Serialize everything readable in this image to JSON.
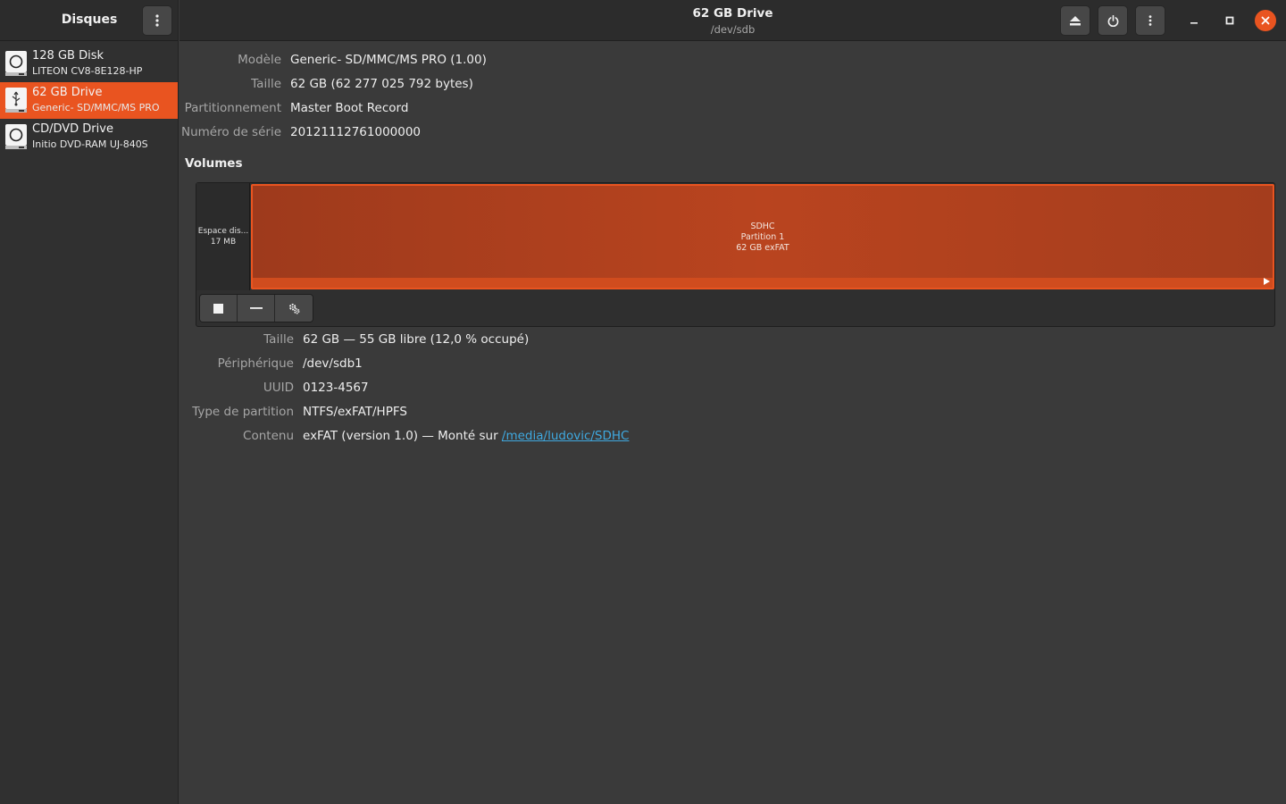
{
  "sidebar": {
    "title": "Disques",
    "menu_icon": "kebab-menu-icon",
    "disks": [
      {
        "name": "128 GB Disk",
        "subtitle": "LITEON CV8-8E128-HP",
        "icon": "hard-disk-icon",
        "selected": false
      },
      {
        "name": "62 GB Drive",
        "subtitle": "Generic- SD/MMC/MS PRO",
        "icon": "usb-drive-icon",
        "selected": true
      },
      {
        "name": "CD/DVD Drive",
        "subtitle": "Initio DVD-RAM UJ-840S",
        "icon": "optical-drive-icon",
        "selected": false
      }
    ]
  },
  "header": {
    "title": "62 GB Drive",
    "subtitle": "/dev/sdb",
    "buttons": {
      "eject_icon": "eject-icon",
      "power_icon": "power-icon",
      "menu_icon": "kebab-menu-icon"
    },
    "window_controls": {
      "minimize_icon": "minimize-icon",
      "maximize_icon": "maximize-icon",
      "close_icon": "close-icon"
    }
  },
  "drive_info": {
    "model_label": "Modèle",
    "model_value": "Generic- SD/MMC/MS PRO (1.00)",
    "size_label": "Taille",
    "size_value": "62 GB (62 277 025 792 bytes)",
    "partitioning_label": "Partitionnement",
    "partitioning_value": "Master Boot Record",
    "serial_label": "Numéro de série",
    "serial_value": "20121112761000000"
  },
  "volumes": {
    "heading": "Volumes",
    "free_space": {
      "line1": "Espace dis...",
      "line2": "17 MB"
    },
    "partition": {
      "line1": "SDHC",
      "line2": "Partition 1",
      "line3": "62 GB exFAT"
    },
    "toolbar": {
      "stop_icon": "stop-icon",
      "remove_icon": "minus-icon",
      "settings_icon": "gears-icon"
    }
  },
  "volume_info": {
    "size_label": "Taille",
    "size_value": "62 GB — 55 GB libre (12,0 % occupé)",
    "device_label": "Périphérique",
    "device_value": "/dev/sdb1",
    "uuid_label": "UUID",
    "uuid_value": "0123-4567",
    "type_label": "Type de partition",
    "type_value": "NTFS/exFAT/HPFS",
    "content_label": "Contenu",
    "content_value": "exFAT (version 1.0) — Monté sur ",
    "mount_link": "/media/ludovic/SDHC"
  },
  "colors": {
    "accent": "#e95420",
    "link": "#3fa9e0",
    "background": "#3a3a3a",
    "sidebar": "#303030"
  }
}
